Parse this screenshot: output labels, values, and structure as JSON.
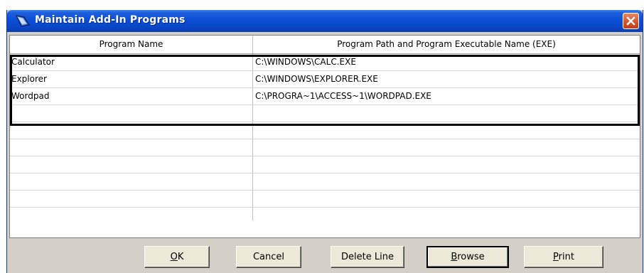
{
  "window": {
    "title": "Maintain Add-In Programs",
    "icon": "app-icon",
    "close_icon": "close-icon"
  },
  "grid": {
    "columns": [
      "Program Name",
      "Program Path and Program Executable Name (EXE)"
    ],
    "rows": [
      {
        "name": "Calculator",
        "path": "C:\\WINDOWS\\CALC.EXE"
      },
      {
        "name": "Explorer",
        "path": "C:\\WINDOWS\\EXPLORER.EXE"
      },
      {
        "name": "Wordpad",
        "path": "C:\\PROGRA~1\\ACCESS~1\\WORDPAD.EXE"
      },
      {
        "name": "",
        "path": ""
      },
      {
        "name": "",
        "path": ""
      },
      {
        "name": "",
        "path": ""
      },
      {
        "name": "",
        "path": ""
      },
      {
        "name": "",
        "path": ""
      },
      {
        "name": "",
        "path": ""
      },
      {
        "name": "",
        "path": ""
      }
    ]
  },
  "buttons": {
    "ok": {
      "mnemonic": "O",
      "rest": "K"
    },
    "cancel": "Cancel",
    "delete_line": "Delete Line",
    "browse": {
      "mnemonic": "B",
      "rest": "rowse"
    },
    "print": {
      "mnemonic": "P",
      "rest": "rint"
    }
  },
  "colors": {
    "titlebar": "#0a4fd6",
    "close_button": "#d8592f",
    "dialog_face": "#d4d0c8"
  }
}
